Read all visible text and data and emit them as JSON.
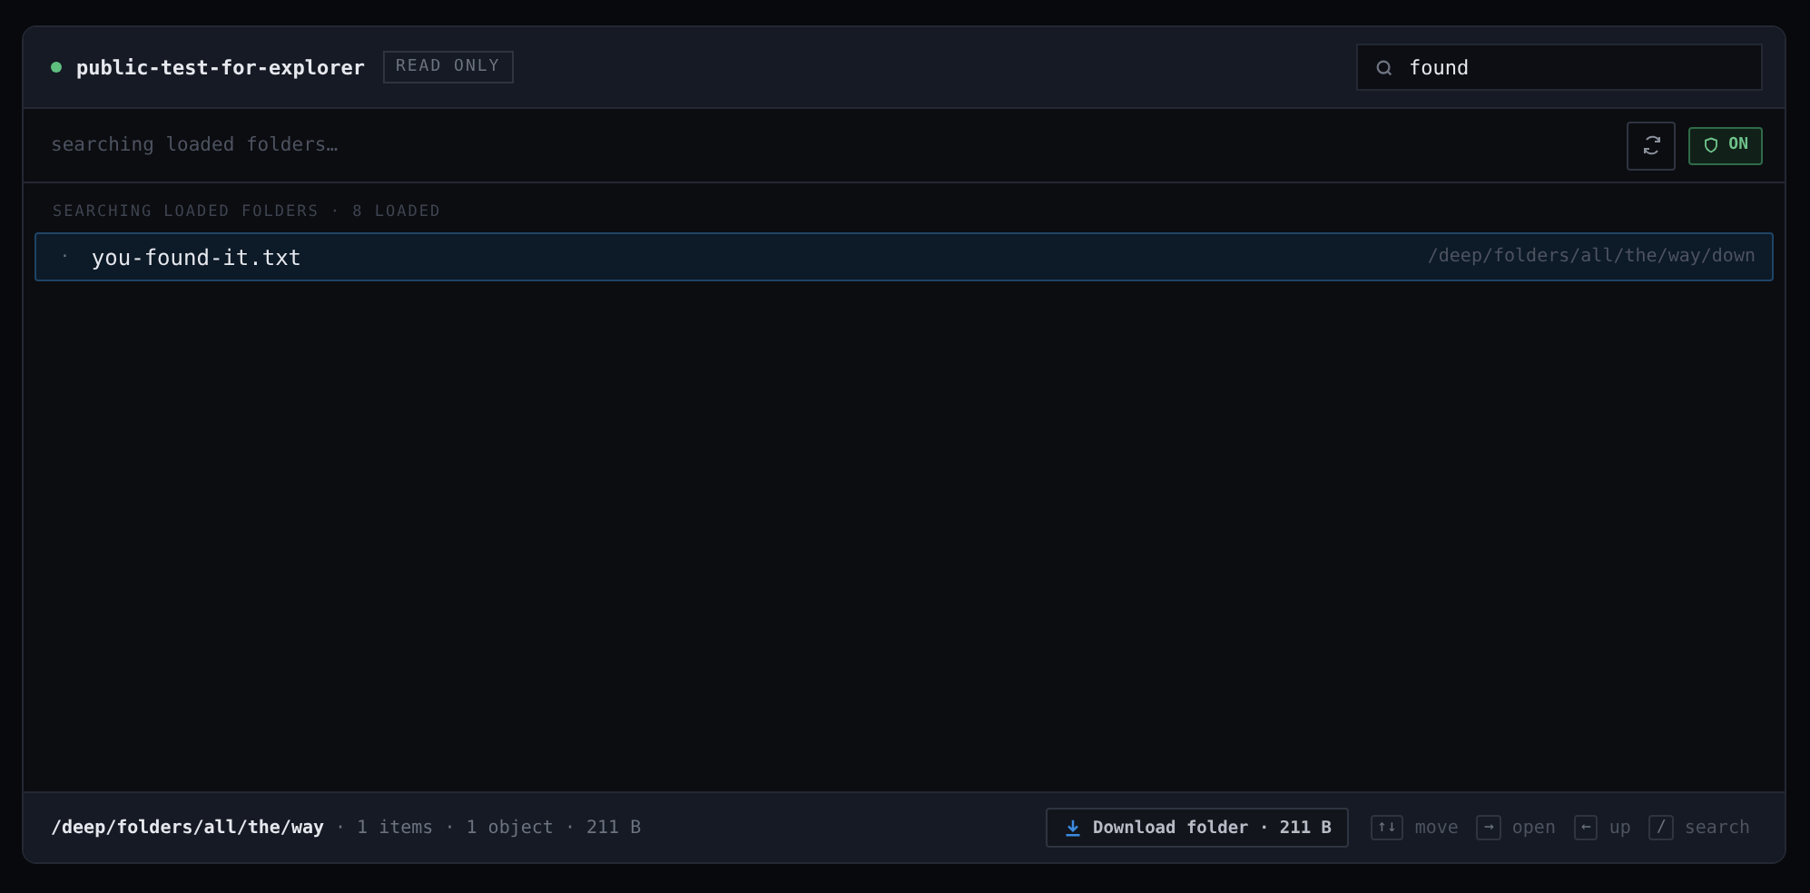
{
  "header": {
    "status_on": true,
    "bucket": "public-test-for-explorer",
    "badge": "READ ONLY",
    "search": {
      "value": "found"
    }
  },
  "toolbar": {
    "status_text": "searching loaded folders…",
    "guard": {
      "label": "ON",
      "on": true
    }
  },
  "section_label": "SEARCHING LOADED FOLDERS · 8 LOADED",
  "results": [
    {
      "bullet": "·",
      "name": "you-found-it.txt",
      "path": "/deep/folders/all/the/way/down",
      "selected": true
    }
  ],
  "footer": {
    "path": "/deep/folders/all/the/way",
    "summary": "· 1 items · 1 object · 211 B",
    "download": "Download folder · 211 B",
    "shortcuts": [
      {
        "key": "↑↓",
        "label": "move"
      },
      {
        "key": "→",
        "label": "open"
      },
      {
        "key": "←",
        "label": "up"
      },
      {
        "key": "/",
        "label": "search"
      }
    ]
  }
}
